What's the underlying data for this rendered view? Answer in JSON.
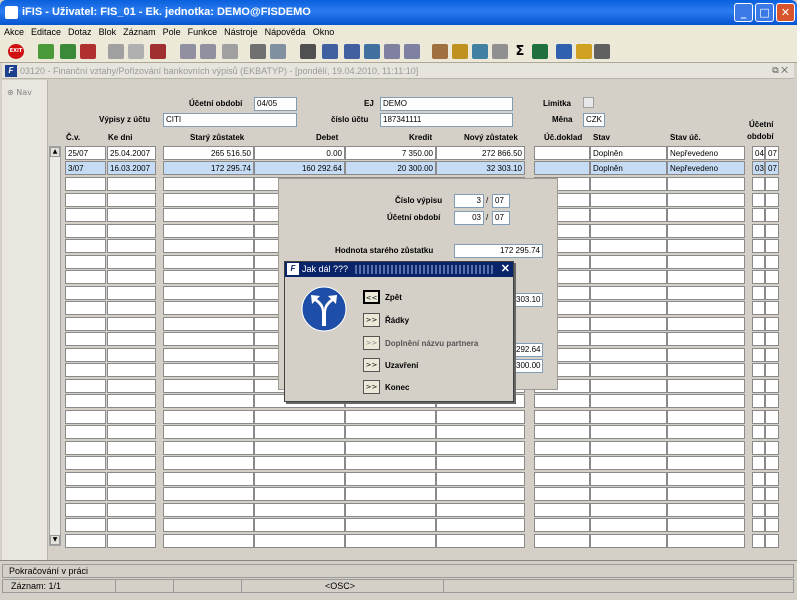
{
  "window": {
    "title": "iFIS - Uživatel: FIS_01 - Ek. jednotka: DEMO@FISDEMO",
    "minimize": "_",
    "maximize": "□",
    "close": "✕"
  },
  "menu": [
    "Akce",
    "Editace",
    "Dotaz",
    "Blok",
    "Záznam",
    "Pole",
    "Funkce",
    "Nástroje",
    "Nápověda",
    "Okno"
  ],
  "toolbar": {
    "exit_label": "EXIT",
    "icons": [
      "save-icon",
      "insert-icon",
      "delete-icon",
      "copy-icon",
      "paste-icon",
      "print-icon",
      "filter-icon",
      "sort-icon",
      "query-icon",
      "calculator-icon",
      "sum-icon",
      "excel-icon",
      "help-icon"
    ]
  },
  "form": {
    "title": "03120 - Finanční vztahy/Pořizování bankovních výpisů (EKBATYP) - [pondělí, 19.04.2010, 11:11:10]",
    "restore": "⧉",
    "close": "✕"
  },
  "nav": {
    "label": "Nav"
  },
  "header": {
    "ucetni_obdobi_label": "Účetní období",
    "ucetni_obdobi_value": "04/05",
    "ej_label": "EJ",
    "ej_value": "DEMO",
    "limitka_label": "Limitka",
    "vypisy_label": "Výpisy z účtu",
    "vypisy_value": "CITI",
    "cislo_uctu_label": "číslo účtu",
    "cislo_uctu_value": "187341111",
    "mena_label": "Měna",
    "mena_value": "CZK"
  },
  "table": {
    "columns": [
      "Č.v.",
      "Ke dni",
      "Starý zůstatek",
      "Debet",
      "Kredit",
      "Nový zůstatek",
      "Úč.doklad",
      "Stav",
      "Stav úč.",
      "Účetní",
      "období"
    ],
    "rows": [
      {
        "cv": "25/07",
        "ke_dni": "25.04.2007",
        "stary": "265 516.50",
        "debet": "0.00",
        "kredit": "7 350.00",
        "novy": "272 866.50",
        "doklad": "",
        "stav": "Doplněn",
        "stav_uc": "Nepřevedeno",
        "ob1": "04",
        "ob2": "07"
      },
      {
        "cv": "3/07",
        "ke_dni": "16.03.2007",
        "stary": "172 295.74",
        "debet": "160 292.64",
        "kredit": "20 300.00",
        "novy": "32 303.10",
        "doklad": "",
        "stav": "Doplněn",
        "stav_uc": "Nepřevedeno",
        "ob1": "03",
        "ob2": "07"
      }
    ]
  },
  "panel": {
    "cislo_vypisu_label": "Číslo výpisu",
    "cislo_vypisu_num": "3",
    "cislo_vypisu_year": "07",
    "ucetni_obdobi_label": "Účetní období",
    "ucetni_obdobi_num": "03",
    "ucetni_obdobi_year": "07",
    "hodnota_label": "Hodnota starého zůstatku",
    "hodnota_value": "172 295.74",
    "value_a": "303.10",
    "value_b": "292.64",
    "value_c": "300.00",
    "slash": "/"
  },
  "dialog": {
    "title": "Jak dál ???",
    "close": "✕",
    "options": [
      {
        "btn": "<<",
        "label": "Zpět"
      },
      {
        "btn": ">>",
        "label": "Řádky"
      },
      {
        "btn": ">>",
        "label": "Doplnění názvu partnera"
      },
      {
        "btn": ">>",
        "label": "Uzavření"
      },
      {
        "btn": ">>",
        "label": "Konec"
      }
    ]
  },
  "status": {
    "line1": "Pokračování v práci",
    "record": "Záznam: 1/1",
    "mode": "<OSC>",
    "scroll_up": "▲",
    "scroll_down": "▼"
  }
}
